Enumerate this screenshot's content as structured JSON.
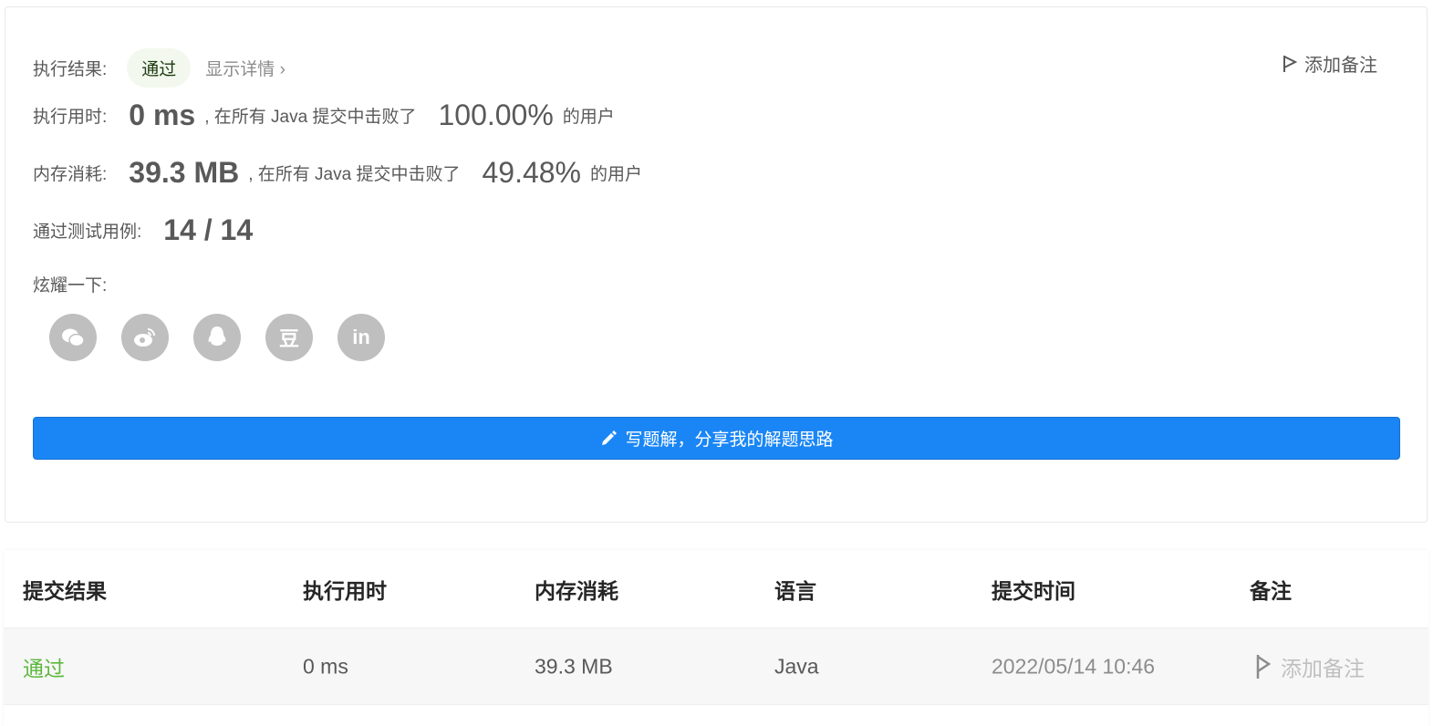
{
  "result": {
    "label": "执行结果:",
    "status": "通过",
    "detail": "显示详情 ›",
    "add_note": "添加备注"
  },
  "runtime": {
    "label": "执行用时:",
    "value": "0 ms",
    "mid": ", 在所有 Java 提交中击败了",
    "percent": "100.00%",
    "suffix": "的用户"
  },
  "memory": {
    "label": "内存消耗:",
    "value": "39.3 MB",
    "mid": ", 在所有 Java 提交中击败了",
    "percent": "49.48%",
    "suffix": "的用户"
  },
  "tests": {
    "label": "通过测试用例:",
    "value": "14 / 14"
  },
  "share": {
    "label": "炫耀一下:",
    "icons": [
      "wechat-icon",
      "weibo-icon",
      "qq-icon",
      "douban-icon",
      "linkedin-icon"
    ],
    "douban_glyph": "豆",
    "linkedin_glyph": "in"
  },
  "write_button": "写题解，分享我的解题思路",
  "table": {
    "headers": [
      "提交结果",
      "执行用时",
      "内存消耗",
      "语言",
      "提交时间",
      "备注"
    ],
    "rows": [
      {
        "status": "通过",
        "runtime": "0 ms",
        "memory": "39.3 MB",
        "language": "Java",
        "time": "2022/05/14 10:46",
        "note": "添加备注"
      }
    ]
  },
  "colors": {
    "accent": "#1a86f5",
    "success": "#5cb83e"
  }
}
